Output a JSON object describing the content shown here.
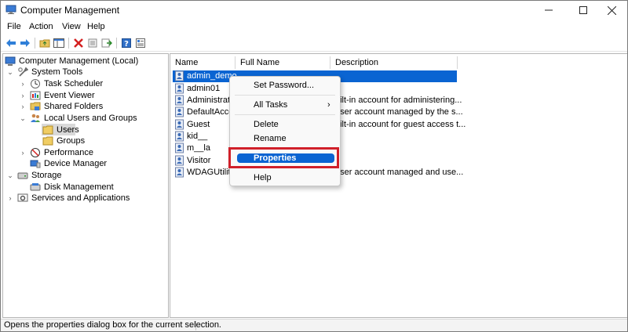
{
  "window": {
    "title": "Computer Management"
  },
  "menubar": {
    "items": [
      "File",
      "Action",
      "View",
      "Help"
    ]
  },
  "tree": {
    "root": "Computer Management (Local)",
    "system_tools": "System Tools",
    "task_scheduler": "Task Scheduler",
    "event_viewer": "Event Viewer",
    "shared_folders": "Shared Folders",
    "local_users_groups": "Local Users and Groups",
    "users": "Users",
    "groups": "Groups",
    "performance": "Performance",
    "device_manager": "Device Manager",
    "storage": "Storage",
    "disk_management": "Disk Management",
    "services_apps": "Services and Applications"
  },
  "list": {
    "columns": [
      "Name",
      "Full Name",
      "Description"
    ],
    "rows": [
      {
        "name": "admin_demo",
        "description": ""
      },
      {
        "name": "admin01",
        "description": ""
      },
      {
        "name": "Administrato",
        "description": "uilt-in account for administering..."
      },
      {
        "name": "DefaultAcco...",
        "description": "user account managed by the s..."
      },
      {
        "name": "Guest",
        "description": "uilt-in account for guest access t..."
      },
      {
        "name": "kid__",
        "description": ""
      },
      {
        "name": "m__la",
        "description": ""
      },
      {
        "name": "Visitor",
        "description": ""
      },
      {
        "name": "WDAGUtility...",
        "description": "user account managed and use..."
      }
    ],
    "selected_row": "admin_demo"
  },
  "context_menu": {
    "set_password": "Set Password...",
    "all_tasks": "All Tasks",
    "delete": "Delete",
    "rename": "Rename",
    "properties": "Properties",
    "help": "Help"
  },
  "statusbar": {
    "text": "Opens the properties dialog box for the current selection."
  },
  "colors": {
    "selection": "#0a64d2",
    "highlight_box": "#d0202a"
  },
  "icons": [
    "back-arrow-icon",
    "forward-arrow-icon",
    "up-folder-icon",
    "show-hide-tree-icon",
    "delete-icon",
    "properties-icon",
    "export-icon",
    "help-icon",
    "snapin-icon"
  ]
}
